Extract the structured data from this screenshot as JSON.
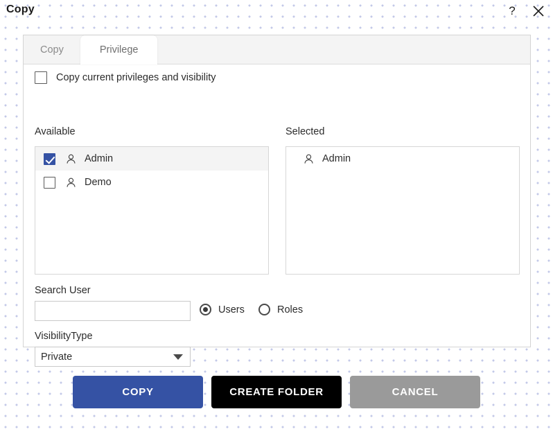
{
  "window": {
    "title": "Copy",
    "help_icon": "question-mark-icon",
    "close_icon": "close-x-icon"
  },
  "tabs": [
    {
      "id": "copy",
      "label": "Copy",
      "active": false
    },
    {
      "id": "privilege",
      "label": "Privilege",
      "active": true
    }
  ],
  "privilege_tab": {
    "copy_privileges_checkbox": {
      "label": "Copy current privileges and visibility",
      "checked": false
    },
    "available": {
      "label": "Available",
      "items": [
        {
          "name": "Admin",
          "checked": true,
          "highlighted": true,
          "icon": "person-icon"
        },
        {
          "name": "Demo",
          "checked": false,
          "highlighted": false,
          "icon": "person-icon"
        }
      ]
    },
    "selected": {
      "label": "Selected",
      "items": [
        {
          "name": "Admin",
          "icon": "person-icon"
        }
      ]
    },
    "search": {
      "label": "Search User",
      "value": "",
      "placeholder": ""
    },
    "search_scope": {
      "options": [
        {
          "id": "users",
          "label": "Users",
          "checked": true
        },
        {
          "id": "roles",
          "label": "Roles",
          "checked": false
        }
      ]
    },
    "visibility": {
      "label": "VisibilityType",
      "value": "Private",
      "caret_icon": "chevron-down-icon"
    }
  },
  "footer": {
    "copy_label": "COPY",
    "create_folder_label": "CREATE FOLDER",
    "cancel_label": "CANCEL"
  },
  "colors": {
    "accent_blue": "#3552a4",
    "black_button": "#000000",
    "cancel_gray": "#9a9a9a",
    "dot_pattern": "#c3c9e8",
    "panel_border": "#d4d4d4"
  }
}
